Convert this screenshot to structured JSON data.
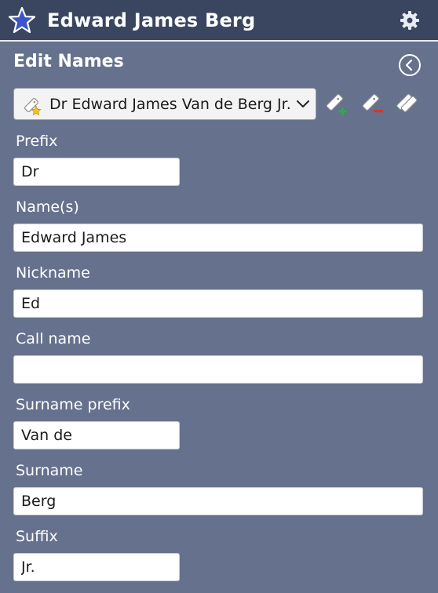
{
  "header": {
    "title": "Edward James Berg",
    "star_icon": "star-icon",
    "settings_icon": "gear-icon"
  },
  "section": {
    "title": "Edit Names",
    "back_icon": "back-circle-icon"
  },
  "name_selector": {
    "selected": "Dr Edward James Van de Berg Jr.",
    "icon": "primary-name-tag-icon"
  },
  "toolbar": {
    "add_icon": "add-name-icon",
    "remove_icon": "remove-name-icon",
    "copy_icon": "copy-name-icon"
  },
  "fields": {
    "prefix": {
      "label": "Prefix",
      "value": "Dr"
    },
    "names": {
      "label": "Name(s)",
      "value": "Edward James"
    },
    "nickname": {
      "label": "Nickname",
      "value": "Ed"
    },
    "callname": {
      "label": "Call name",
      "value": ""
    },
    "surname_prefix": {
      "label": "Surname prefix",
      "value": "Van de"
    },
    "surname": {
      "label": "Surname",
      "value": "Berg"
    },
    "suffix": {
      "label": "Suffix",
      "value": "Jr."
    }
  },
  "colors": {
    "background": "#66718d",
    "titlebar": "#3a4660",
    "star": "#3d54c9",
    "add_accent": "#2fa84a",
    "remove_accent": "#d9342f"
  }
}
